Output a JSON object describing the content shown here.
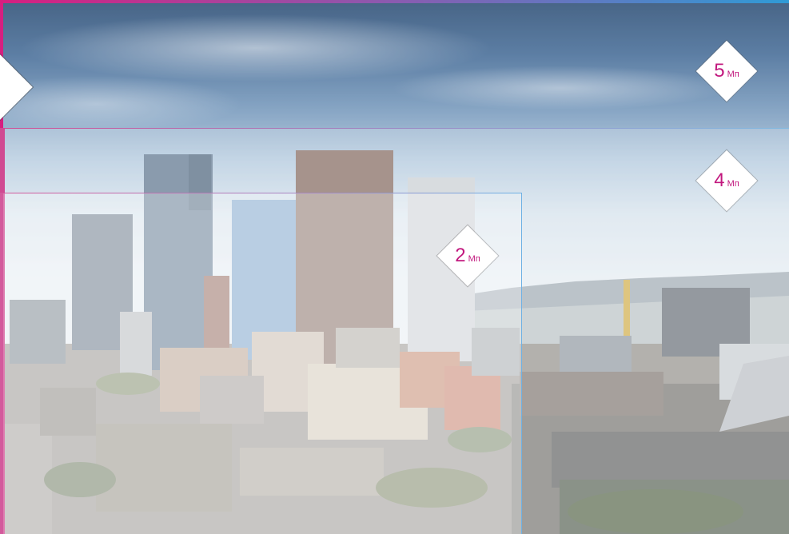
{
  "scene": {
    "description_icon": "city-skyline-photo"
  },
  "badges": [
    {
      "id": "5mp",
      "number": "5",
      "unit": "Мп"
    },
    {
      "id": "4mp",
      "number": "4",
      "unit": "Мп"
    },
    {
      "id": "2mp",
      "number": "2",
      "unit": "Мп"
    }
  ],
  "colors": {
    "accent_magenta": "#c2187e",
    "frame_pink": "#d61f80",
    "frame_blue": "#2f9bd6"
  }
}
